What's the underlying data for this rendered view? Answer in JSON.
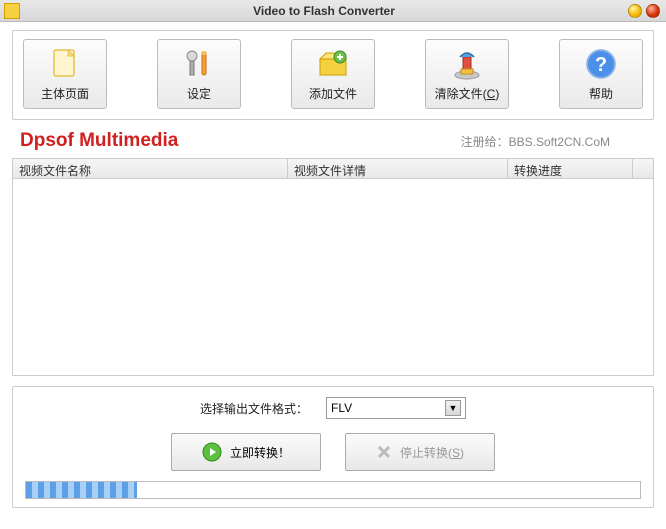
{
  "window": {
    "title": "Video to Flash Converter"
  },
  "toolbar": {
    "home": "主体页面",
    "settings": "设定",
    "add_file": "添加文件",
    "clear_files": "清除文件(",
    "clear_files_u": "C",
    "clear_files_after": ")",
    "help": "帮助"
  },
  "brand": "Dpsof Multimedia",
  "registered_label": "注册给：",
  "registered_to": "BBS.Soft2CN.CoM",
  "columns": {
    "name": "视频文件名称",
    "detail": "视频文件详情",
    "progress": "转换进度"
  },
  "format": {
    "label": "选择输出文件格式：",
    "selected": "FLV"
  },
  "actions": {
    "start": "立即转换！",
    "stop": "停止转换(",
    "stop_u": "S",
    "stop_after": ")"
  }
}
